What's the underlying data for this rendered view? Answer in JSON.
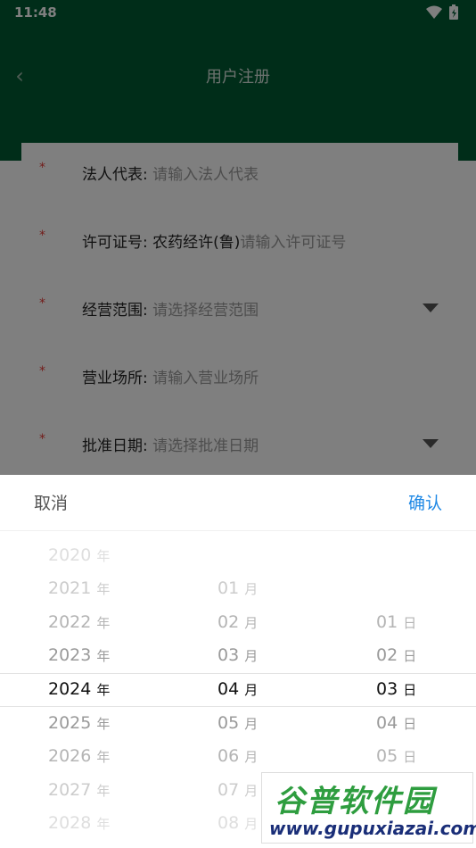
{
  "status_bar": {
    "time": "11:48"
  },
  "nav": {
    "back_icon": "chevron-left-icon",
    "title": "用户注册"
  },
  "form": {
    "required_mark": "*",
    "rows": [
      {
        "label": "法人代表:",
        "value": "",
        "placeholder": "请输入法人代表",
        "dropdown": false
      },
      {
        "label": "许可证号:",
        "value": "农药经许(鲁)",
        "placeholder": "请输入许可证号",
        "dropdown": false
      },
      {
        "label": "经营范围:",
        "value": "",
        "placeholder": "请选择经营范围",
        "dropdown": true
      },
      {
        "label": "营业场所:",
        "value": "",
        "placeholder": "请输入营业场所",
        "dropdown": false
      },
      {
        "label": "批准日期:",
        "value": "",
        "placeholder": "请选择批准日期",
        "dropdown": true
      }
    ]
  },
  "picker": {
    "cancel_label": "取消",
    "confirm_label": "确认",
    "year_unit": "年",
    "month_unit": "月",
    "day_unit": "日",
    "years": [
      "2020",
      "2021",
      "2022",
      "2023",
      "2024",
      "2025",
      "2026",
      "2027",
      "2028"
    ],
    "months": [
      "01",
      "02",
      "03",
      "04",
      "05",
      "06",
      "07",
      "08"
    ],
    "days": [
      "01",
      "02",
      "03",
      "04",
      "05"
    ],
    "selected": {
      "year": "2024",
      "month": "04",
      "day": "03"
    }
  },
  "watermark": {
    "title": "谷普软件园",
    "url": "www.gupuxiazai.com"
  },
  "colors": {
    "header": "#005a32",
    "confirm": "#1e88e5",
    "required": "#e53935"
  }
}
